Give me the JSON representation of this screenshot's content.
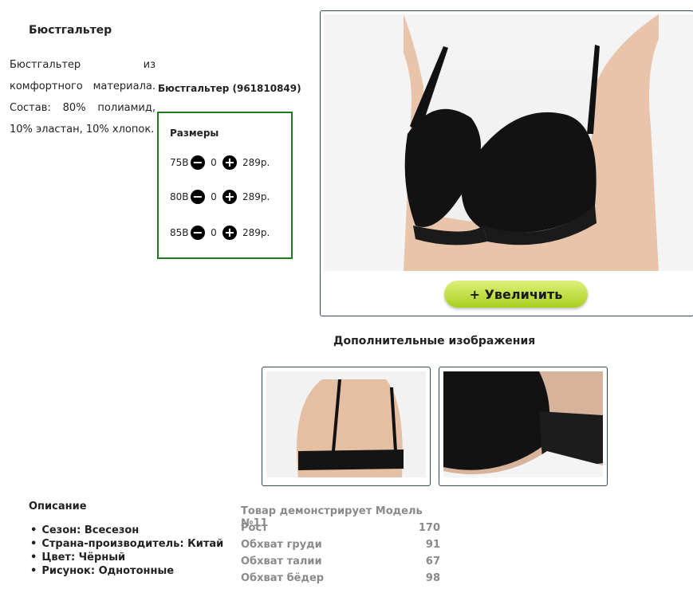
{
  "product": {
    "title": "Бюстгальтер",
    "description": "Бюстгальтер из комфортного материала. Состав: 80% полиамид, 10% эластан, 10% хлопок.",
    "sku_title": "Бюстгальтер (961810849)"
  },
  "sizes": {
    "heading": "Размеры",
    "rows": [
      {
        "size": "75B",
        "qty": "0",
        "price": "289р."
      },
      {
        "size": "80B",
        "qty": "0",
        "price": "289р."
      },
      {
        "size": "85B",
        "qty": "0",
        "price": "289р."
      }
    ],
    "minus_icon": "minus-circle-icon",
    "plus_icon": "plus-circle-icon"
  },
  "gallery": {
    "zoom_label": "+  Увеличить",
    "additional_heading": "Дополнительные изображения"
  },
  "details": {
    "heading": "Описание",
    "props": [
      "Сезон: Всесезон",
      "Страна-производитель: Китай",
      "Цвет: Чёрный",
      "Рисунок: Однотонные"
    ]
  },
  "model": {
    "heading": "Товар демонстрирует Модель №11",
    "rows": [
      {
        "label": "Рост",
        "value": "170"
      },
      {
        "label": "Обхват груди",
        "value": "91"
      },
      {
        "label": "Обхват талии",
        "value": "67"
      },
      {
        "label": "Обхват бёдер",
        "value": "98"
      }
    ]
  },
  "colors": {
    "border_green": "#1f7a1f",
    "frame_blue": "#2d4a6b",
    "button_green": "#a8cf1e"
  }
}
